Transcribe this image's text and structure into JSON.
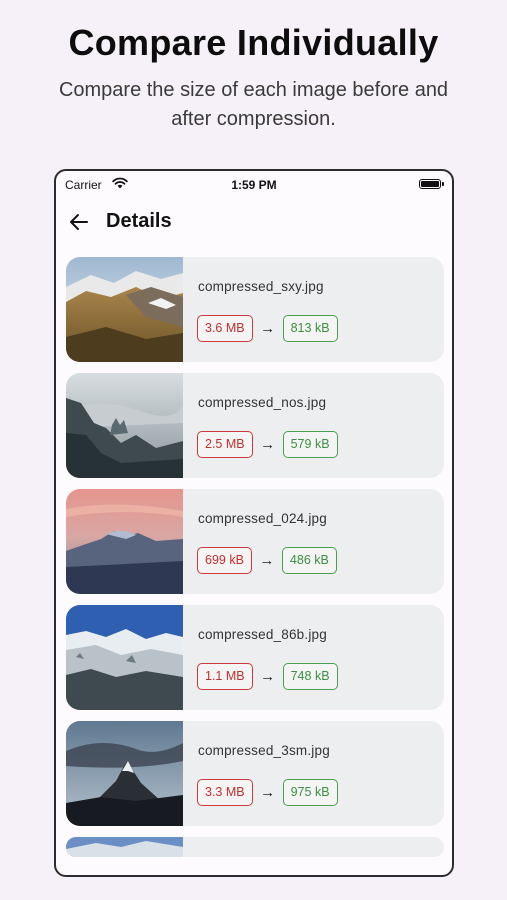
{
  "headline": "Compare Individually",
  "subhead": "Compare the size of each image before and after compression.",
  "status_bar": {
    "carrier": "Carrier",
    "time": "1:59 PM"
  },
  "nav": {
    "title": "Details"
  },
  "images": [
    {
      "name": "compressed_sxy.jpg",
      "before": "3.6 MB",
      "after": "813 kB"
    },
    {
      "name": "compressed_nos.jpg",
      "before": "2.5 MB",
      "after": "579 kB"
    },
    {
      "name": "compressed_024.jpg",
      "before": "699 kB",
      "after": "486 kB"
    },
    {
      "name": "compressed_86b.jpg",
      "before": "1.1 MB",
      "after": "748 kB"
    },
    {
      "name": "compressed_3sm.jpg",
      "before": "3.3 MB",
      "after": "975 kB"
    }
  ],
  "arrow_glyph": "→",
  "colors": {
    "before": "#c0302f",
    "after": "#3b8f40",
    "background": "#f6f1f8"
  },
  "icons": [
    "wifi-icon",
    "battery-icon",
    "back-arrow-icon"
  ]
}
